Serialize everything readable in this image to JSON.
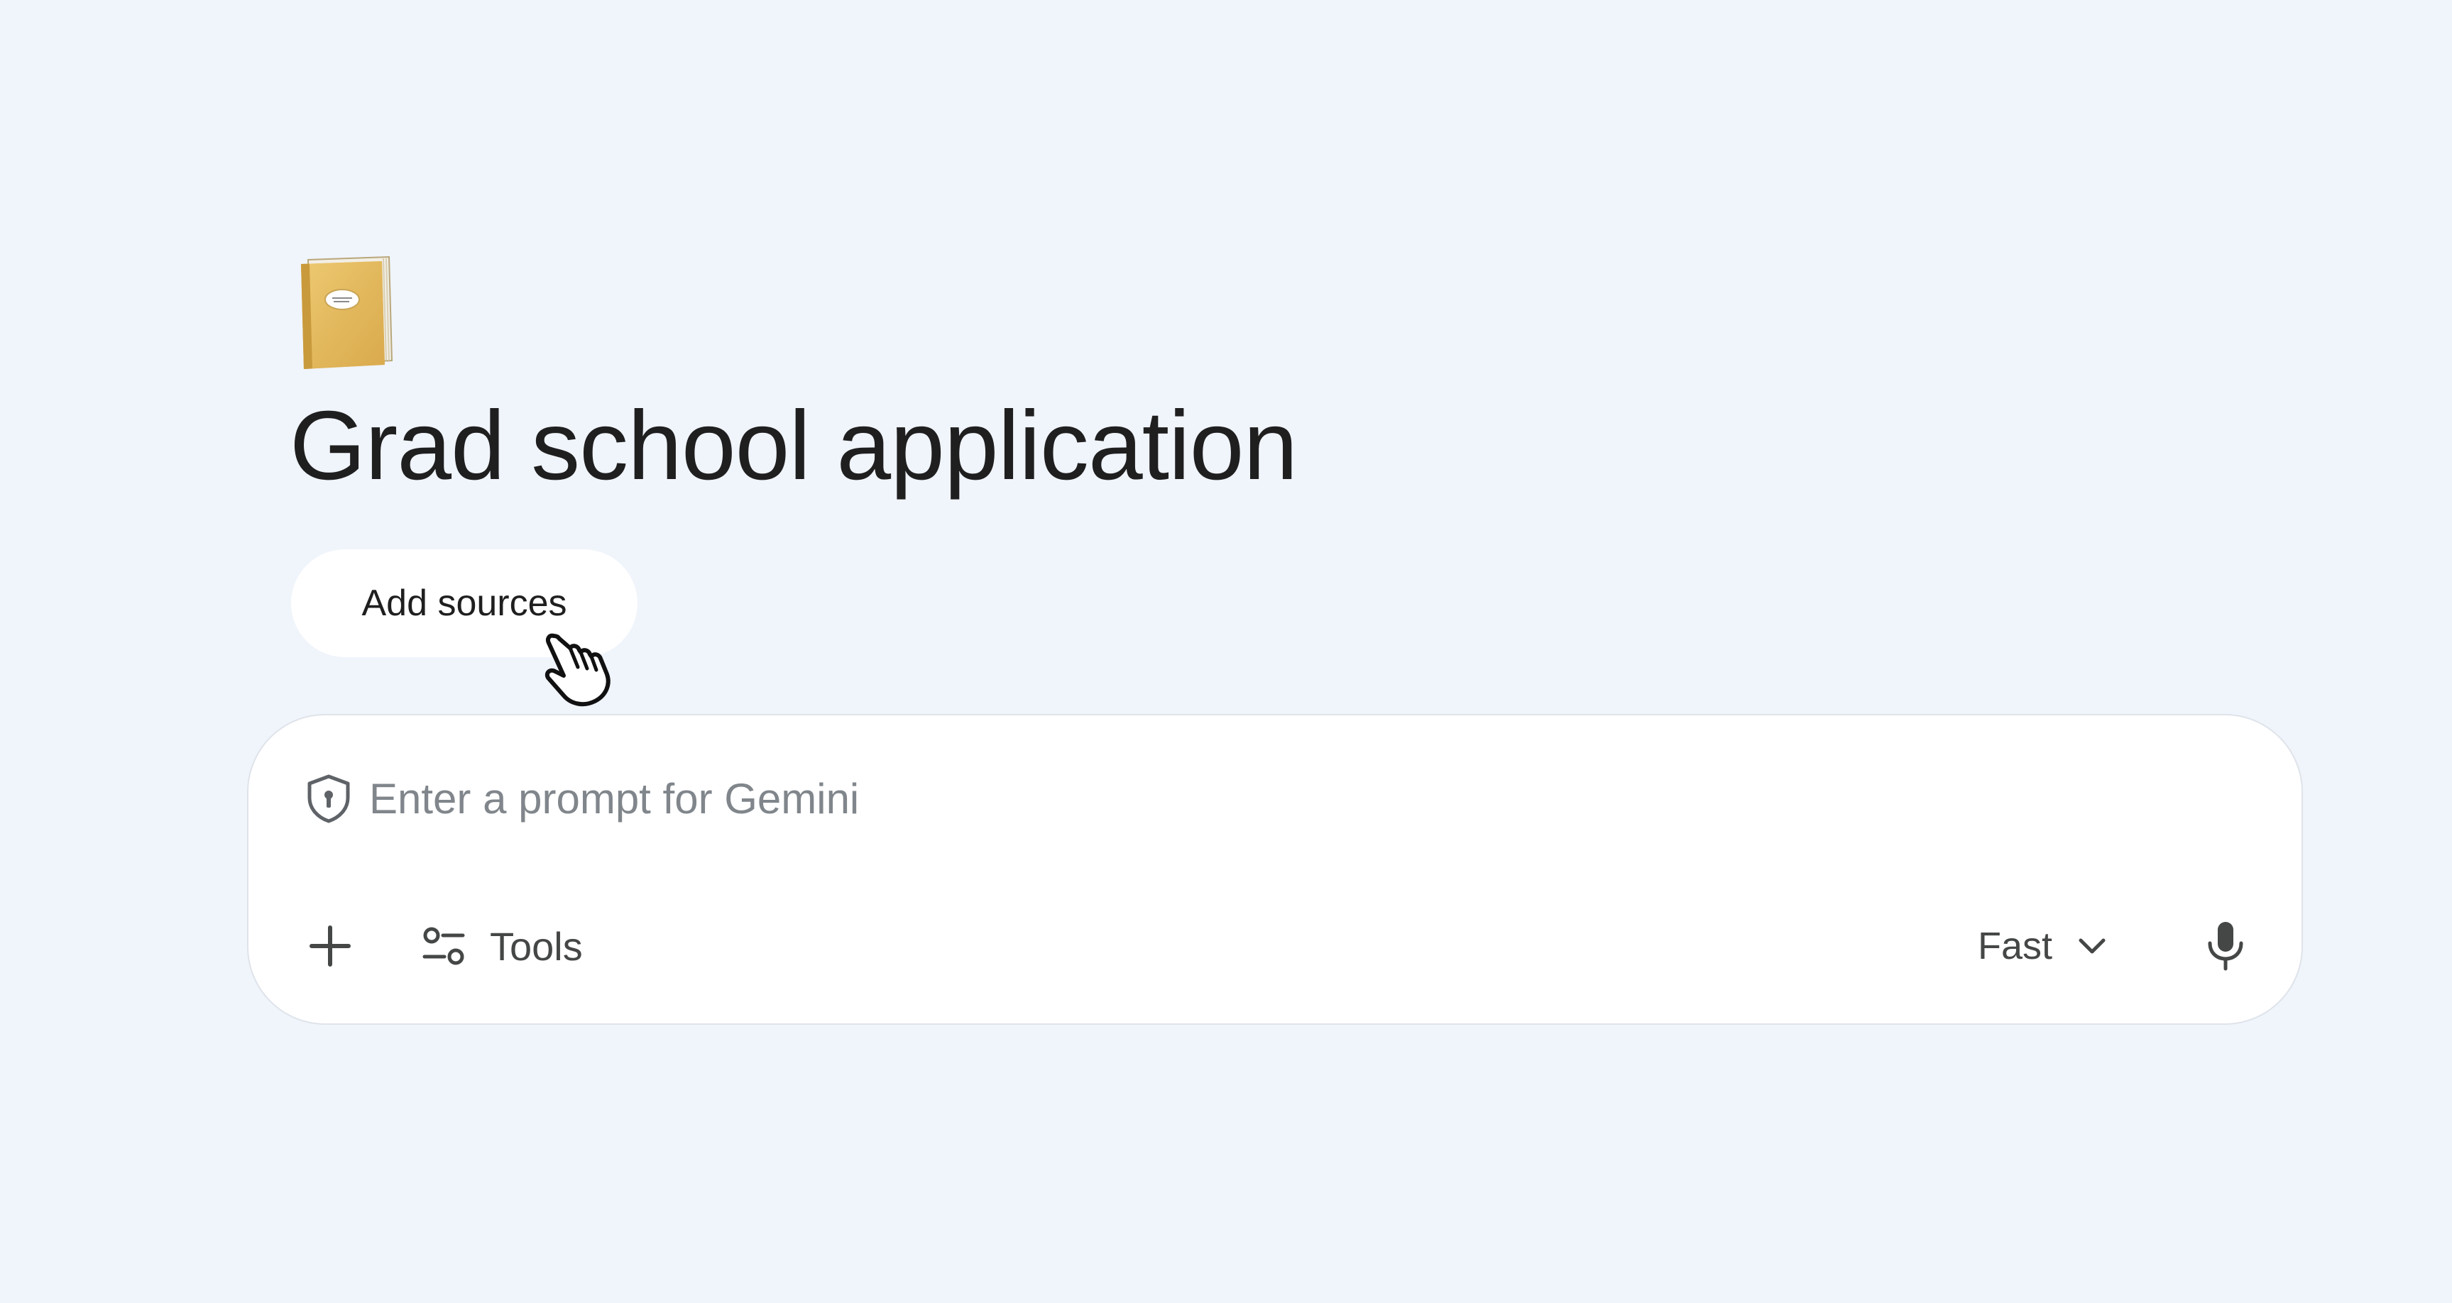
{
  "notebook": {
    "icon": "notebook-book-icon",
    "title": "Grad school application"
  },
  "actions": {
    "add_sources_label": "Add sources"
  },
  "prompt": {
    "placeholder": "Enter a prompt for Gemini",
    "value": "",
    "shield_icon": "shield-lock-icon",
    "add_icon": "plus-icon",
    "tools_icon": "tools-sliders-icon",
    "tools_label": "Tools",
    "model_selected": "Fast",
    "model_icon": "chevron-down-icon",
    "mic_icon": "microphone-icon"
  },
  "colors": {
    "background": "#f0f4fb",
    "card": "#ffffff",
    "text": "#1f1f1f",
    "placeholder": "#80868b",
    "notebook_cover": "#e6c069"
  }
}
